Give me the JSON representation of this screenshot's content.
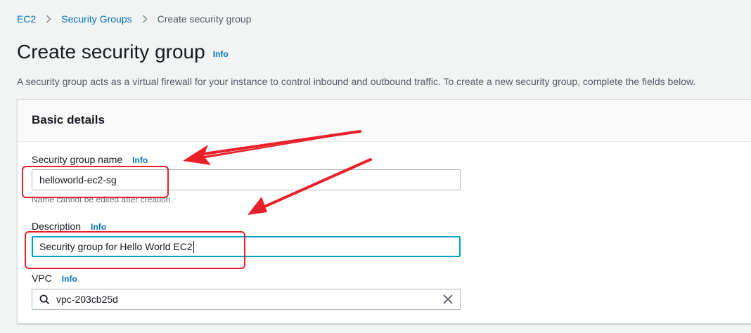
{
  "breadcrumb": {
    "items": [
      {
        "label": "EC2"
      },
      {
        "label": "Security Groups"
      },
      {
        "label": "Create security group"
      }
    ]
  },
  "page": {
    "title": "Create security group",
    "info_label": "Info",
    "description": "A security group acts as a virtual firewall for your instance to control inbound and outbound traffic. To create a new security group, complete the fields below."
  },
  "basic_details": {
    "title": "Basic details",
    "name_field": {
      "label": "Security group name",
      "info_label": "Info",
      "value": "helloworld-ec2-sg",
      "constraint": "Name cannot be edited after creation."
    },
    "description_field": {
      "label": "Description",
      "info_label": "Info",
      "value": "Security group for Hello World EC2"
    },
    "vpc_field": {
      "label": "VPC",
      "info_label": "Info",
      "value": "vpc-203cb25d"
    }
  },
  "icons": {
    "breadcrumb_separator": "chevron-right-icon",
    "vpc_search": "search-icon",
    "vpc_clear": "close-icon"
  },
  "colors": {
    "link": "#0073bb",
    "focus_border": "#00a1c9",
    "annotation": "#e8202a"
  }
}
